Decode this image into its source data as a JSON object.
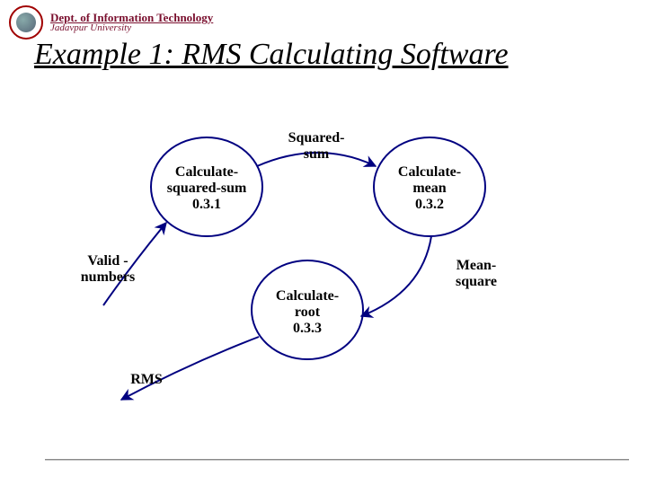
{
  "header": {
    "dept_line1": "Dept. of Information Technology",
    "dept_line2": "Jadavpur University"
  },
  "title": "Example 1: RMS Calculating Software",
  "nodes": {
    "n1_l1": "Calculate-",
    "n1_l2": "squared-sum",
    "n1_l3": "0.3.1",
    "n2_l1": "Calculate-",
    "n2_l2": "mean",
    "n2_l3": "0.3.2",
    "n3_l1": "Calculate-",
    "n3_l2": "root",
    "n3_l3": "0.3.3"
  },
  "edges": {
    "valid_l1": "Valid -",
    "valid_l2": "numbers",
    "sq_l1": "Squared-",
    "sq_l2": "sum",
    "mean_l1": "Mean-",
    "mean_l2": "square",
    "rms": "RMS"
  }
}
